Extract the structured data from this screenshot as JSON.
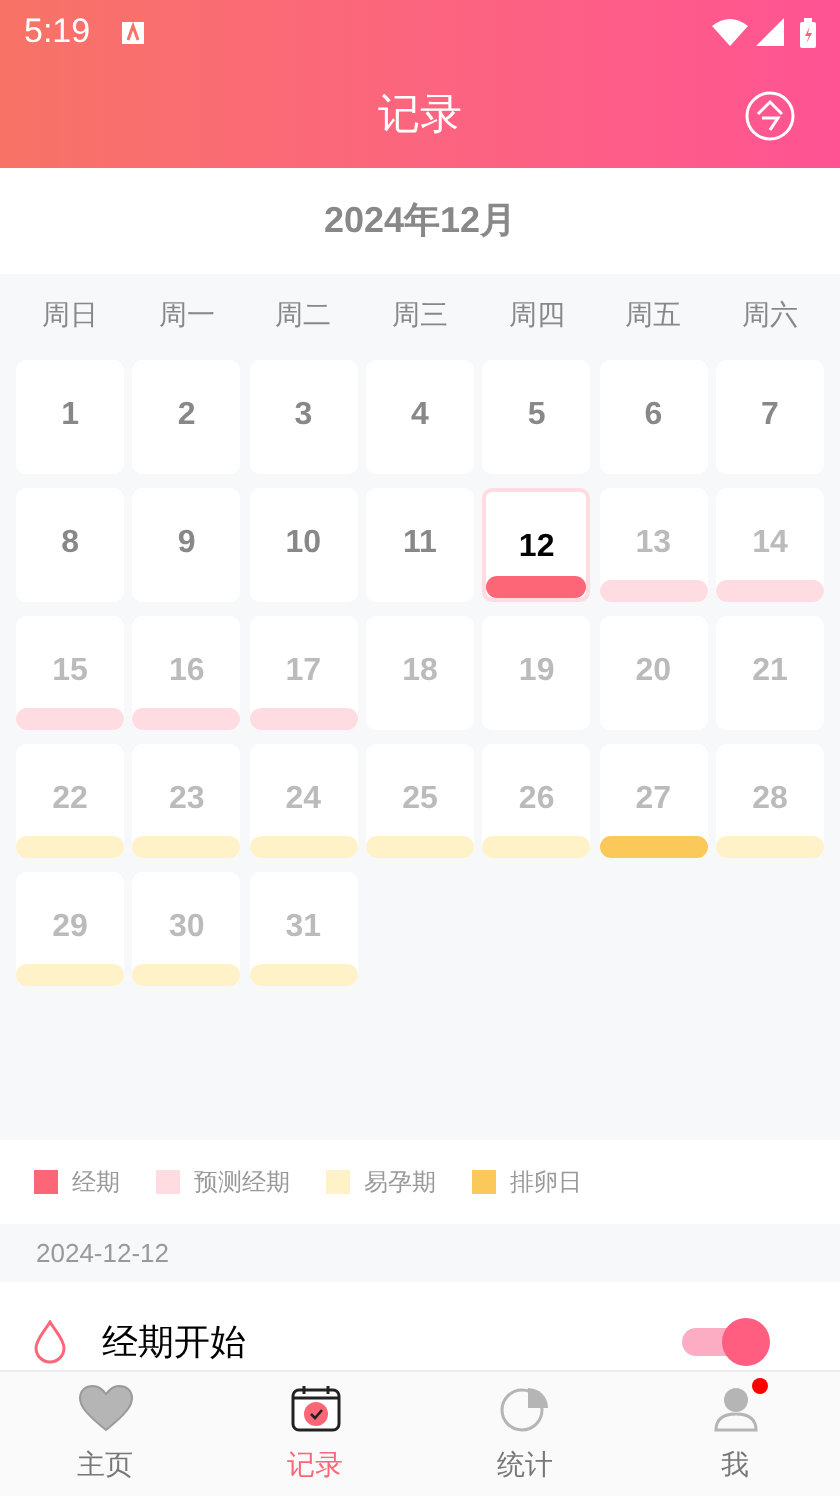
{
  "status_bar": {
    "time": "5:19"
  },
  "header": {
    "title": "记录"
  },
  "calendar": {
    "month": "2024年12月",
    "weekdays": [
      "周日",
      "周一",
      "周二",
      "周三",
      "周四",
      "周五",
      "周六"
    ],
    "days": [
      {
        "day": "1",
        "future": false,
        "selected": false,
        "kind": "none"
      },
      {
        "day": "2",
        "future": false,
        "selected": false,
        "kind": "none"
      },
      {
        "day": "3",
        "future": false,
        "selected": false,
        "kind": "none"
      },
      {
        "day": "4",
        "future": false,
        "selected": false,
        "kind": "none"
      },
      {
        "day": "5",
        "future": false,
        "selected": false,
        "kind": "none"
      },
      {
        "day": "6",
        "future": false,
        "selected": false,
        "kind": "none"
      },
      {
        "day": "7",
        "future": false,
        "selected": false,
        "kind": "none"
      },
      {
        "day": "8",
        "future": false,
        "selected": false,
        "kind": "none"
      },
      {
        "day": "9",
        "future": false,
        "selected": false,
        "kind": "none"
      },
      {
        "day": "10",
        "future": false,
        "selected": false,
        "kind": "none"
      },
      {
        "day": "11",
        "future": false,
        "selected": false,
        "kind": "none"
      },
      {
        "day": "12",
        "future": false,
        "selected": true,
        "kind": "period"
      },
      {
        "day": "13",
        "future": true,
        "selected": false,
        "kind": "predicted"
      },
      {
        "day": "14",
        "future": true,
        "selected": false,
        "kind": "predicted"
      },
      {
        "day": "15",
        "future": true,
        "selected": false,
        "kind": "predicted"
      },
      {
        "day": "16",
        "future": true,
        "selected": false,
        "kind": "predicted"
      },
      {
        "day": "17",
        "future": true,
        "selected": false,
        "kind": "predicted"
      },
      {
        "day": "18",
        "future": true,
        "selected": false,
        "kind": "none"
      },
      {
        "day": "19",
        "future": true,
        "selected": false,
        "kind": "none"
      },
      {
        "day": "20",
        "future": true,
        "selected": false,
        "kind": "none"
      },
      {
        "day": "21",
        "future": true,
        "selected": false,
        "kind": "none"
      },
      {
        "day": "22",
        "future": true,
        "selected": false,
        "kind": "fertile"
      },
      {
        "day": "23",
        "future": true,
        "selected": false,
        "kind": "fertile"
      },
      {
        "day": "24",
        "future": true,
        "selected": false,
        "kind": "fertile"
      },
      {
        "day": "25",
        "future": true,
        "selected": false,
        "kind": "fertile"
      },
      {
        "day": "26",
        "future": true,
        "selected": false,
        "kind": "fertile"
      },
      {
        "day": "27",
        "future": true,
        "selected": false,
        "kind": "ovulation"
      },
      {
        "day": "28",
        "future": true,
        "selected": false,
        "kind": "fertile"
      },
      {
        "day": "29",
        "future": true,
        "selected": false,
        "kind": "fertile"
      },
      {
        "day": "30",
        "future": true,
        "selected": false,
        "kind": "fertile"
      },
      {
        "day": "31",
        "future": true,
        "selected": false,
        "kind": "fertile"
      }
    ]
  },
  "legend": [
    {
      "label": "经期",
      "color": "#fd6677"
    },
    {
      "label": "预测经期",
      "color": "#ffdce1"
    },
    {
      "label": "易孕期",
      "color": "#fff1c8"
    },
    {
      "label": "排卵日",
      "color": "#fbc95a"
    }
  ],
  "record": {
    "date": "2024-12-12",
    "label": "经期开始",
    "on": true
  },
  "tabs": [
    {
      "label": "主页",
      "selected": false,
      "kind": "home"
    },
    {
      "label": "记录",
      "selected": true,
      "kind": "record"
    },
    {
      "label": "统计",
      "selected": false,
      "kind": "stats"
    },
    {
      "label": "我",
      "selected": false,
      "kind": "me",
      "badge": true
    }
  ]
}
